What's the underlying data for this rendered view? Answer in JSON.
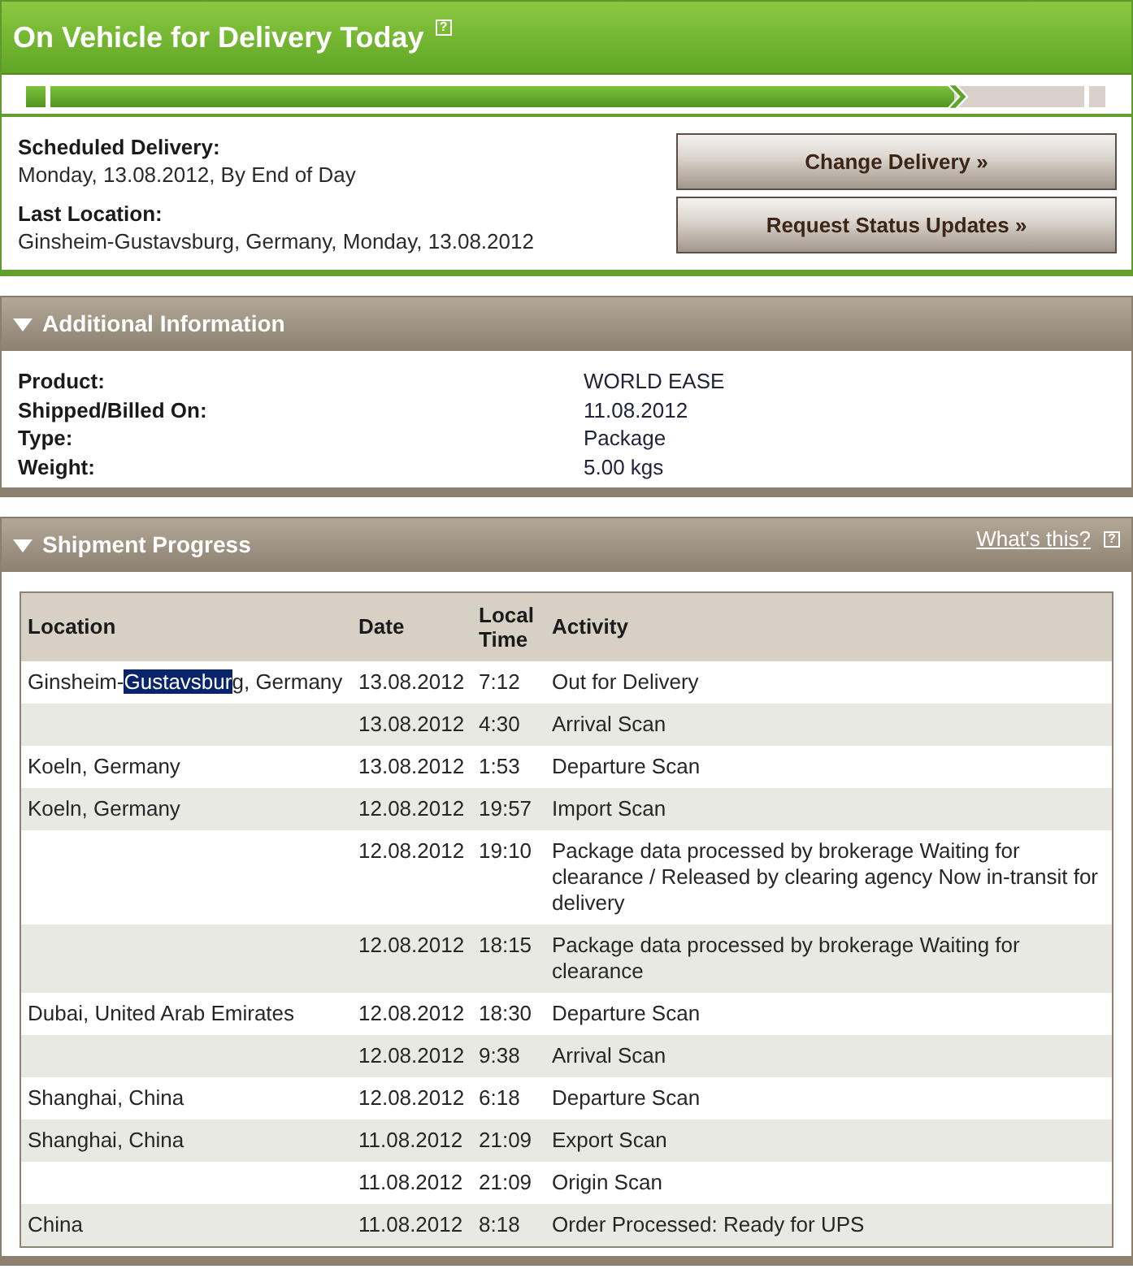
{
  "status_panel": {
    "title": "On Vehicle for Delivery Today",
    "help": "?",
    "progress": {
      "level": 0.86
    },
    "details": [
      {
        "label": "Scheduled Delivery:",
        "value": "Monday, 13.08.2012, By End of Day"
      },
      {
        "label": "Last Location:",
        "value": "Ginsheim-Gustavsburg, Germany, Monday, 13.08.2012"
      }
    ],
    "buttons": [
      "Change Delivery »",
      "Request Status Updates »"
    ]
  },
  "additional_information": {
    "title": "Additional Information",
    "expanded": true,
    "fields": [
      {
        "label": "Product:",
        "value": "WORLD EASE"
      },
      {
        "label": "Shipped/Billed On:",
        "value": "11.08.2012"
      },
      {
        "label": "Type:",
        "value": "Package"
      },
      {
        "label": "Weight:",
        "value": "5.00 kgs"
      }
    ]
  },
  "shipment_progress": {
    "title": "Shipment Progress",
    "expanded": true,
    "help_link": "What's this?",
    "help": "?",
    "table": {
      "columns": [
        "Location",
        "Date",
        "Local Time",
        "Activity"
      ],
      "rows": [
        {
          "location_parts": [
            {
              "text": "Ginsheim-",
              "selected": false
            },
            {
              "text": "Gustavsbur",
              "selected": true
            },
            {
              "text": "g, Germany",
              "selected": false
            }
          ],
          "date": "13.08.2012",
          "local_time": "7:12",
          "activity": "Out for Delivery"
        },
        {
          "date": "13.08.2012",
          "local_time": "4:30",
          "activity": "Arrival Scan"
        },
        {
          "location": "Koeln, Germany",
          "date": "13.08.2012",
          "local_time": "1:53",
          "activity": "Departure Scan"
        },
        {
          "location": "Koeln, Germany",
          "date": "12.08.2012",
          "local_time": "19:57",
          "activity": "Import Scan"
        },
        {
          "date": "12.08.2012",
          "local_time": "19:10",
          "activity": "Package data processed by brokerage Waiting for clearance / Released by clearing agency Now in-transit for delivery"
        },
        {
          "date": "12.08.2012",
          "local_time": "18:15",
          "activity": "Package data processed by brokerage Waiting for clearance"
        },
        {
          "location": "Dubai, United Arab Emirates",
          "date": "12.08.2012",
          "local_time": "18:30",
          "activity": "Departure Scan"
        },
        {
          "date": "12.08.2012",
          "local_time": "9:38",
          "activity": "Arrival Scan"
        },
        {
          "location": "Shanghai, China",
          "date": "12.08.2012",
          "local_time": "6:18",
          "activity": "Departure Scan"
        },
        {
          "location": "Shanghai, China",
          "date": "11.08.2012",
          "local_time": "21:09",
          "activity": "Export Scan"
        },
        {
          "date": "11.08.2012",
          "local_time": "21:09",
          "activity": "Origin Scan"
        },
        {
          "location": "China",
          "date": "11.08.2012",
          "local_time": "8:18",
          "activity": "Order Processed: Ready for UPS"
        }
      ]
    }
  }
}
